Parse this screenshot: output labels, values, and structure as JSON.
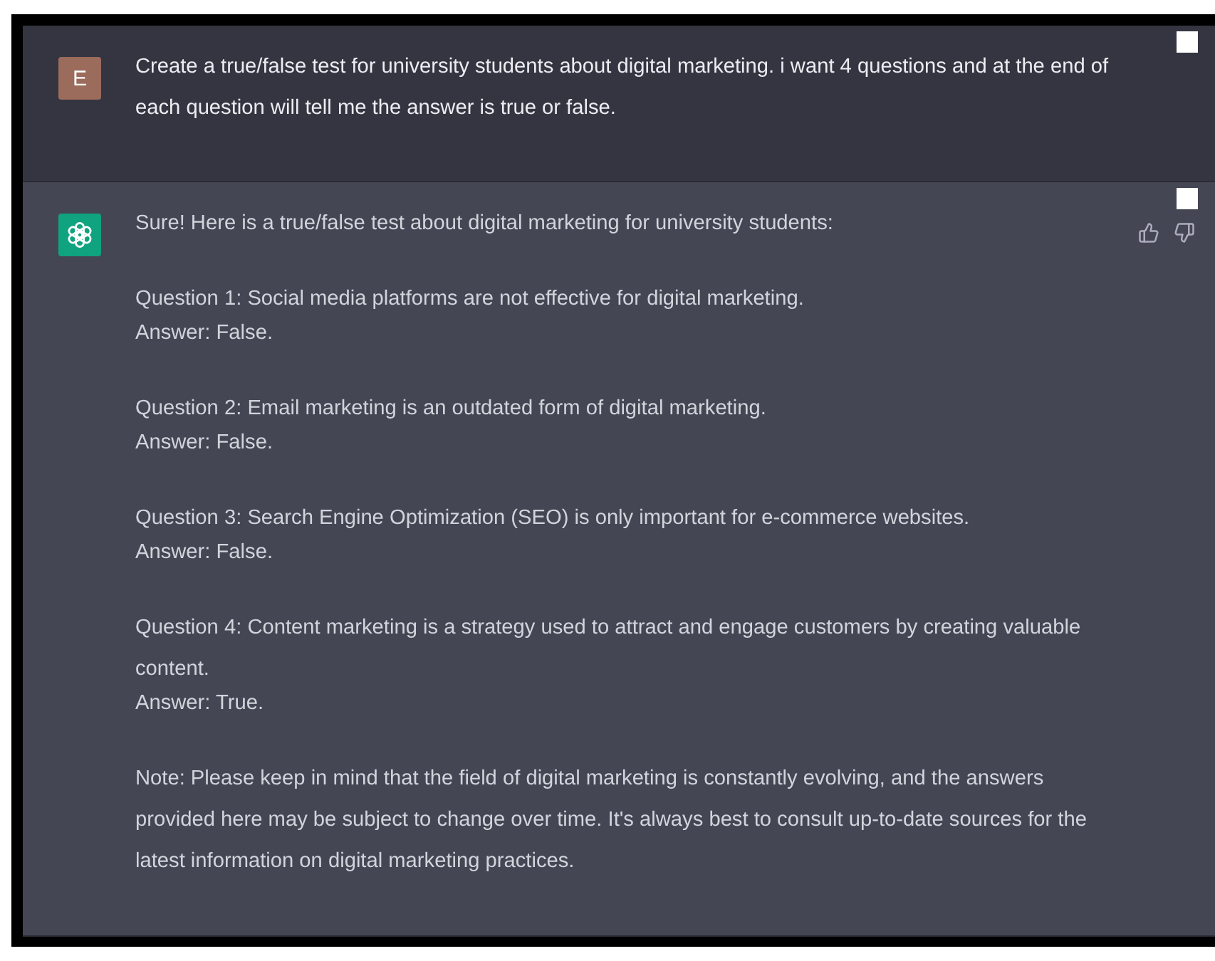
{
  "messages": [
    {
      "kind": "user",
      "avatar": "E",
      "paragraphs": [
        [
          "Create a true/false test for university students about digital marketing. i want 4 questions and at the end of each question will tell me the answer is true or false."
        ]
      ]
    },
    {
      "kind": "assistant",
      "paragraphs": [
        [
          "Sure! Here is a true/false test about digital marketing for university students:"
        ],
        [
          "Question 1: Social media platforms are not effective for digital marketing.",
          "Answer: False."
        ],
        [
          "Question 2: Email marketing is an outdated form of digital marketing.",
          "Answer: False."
        ],
        [
          "Question 3: Search Engine Optimization (SEO) is only important for e-commerce websites.",
          "Answer: False."
        ],
        [
          "Question 4: Content marketing is a strategy used to attract and engage customers by creating valuable content.",
          "Answer: True."
        ],
        [
          "Note: Please keep in mind that the field of digital marketing is constantly evolving, and the answers provided here may be subject to change over time. It's always best to consult up-to-date sources for the latest information on digital marketing practices."
        ]
      ]
    }
  ]
}
